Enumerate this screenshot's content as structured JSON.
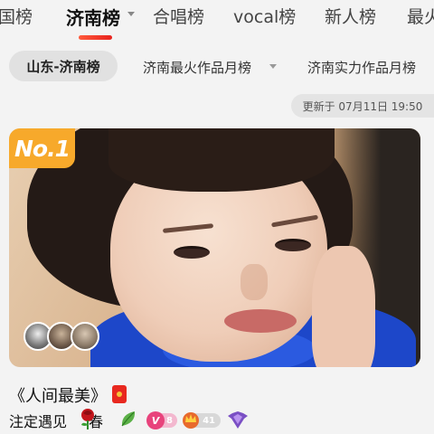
{
  "top_tabs": [
    {
      "label": "国榜"
    },
    {
      "label": "济南榜"
    },
    {
      "label": "合唱榜"
    },
    {
      "label": "vocal榜"
    },
    {
      "label": "新人榜"
    },
    {
      "label": "最火"
    }
  ],
  "sub_tabs": [
    {
      "label": "山东-济南榜"
    },
    {
      "label": "济南最火作品月榜"
    },
    {
      "label": "济南实力作品月榜"
    }
  ],
  "update_time": "更新于 07月11日 19:50",
  "rank_badge": "No.1",
  "song_title": "《人间最美》",
  "singer_name_prefix": "注定遇见",
  "singer_name_suffix": "春",
  "vip_level": "8",
  "wealth_level": "41",
  "colors": {
    "accent": "#e8231e",
    "rank_badge": "#f7a92b",
    "vip_badge": "#e8437c"
  },
  "icons": [
    "red-packet-icon",
    "rose-icon",
    "leaf-icon",
    "vip-icon",
    "crown-icon",
    "shield-icon"
  ]
}
